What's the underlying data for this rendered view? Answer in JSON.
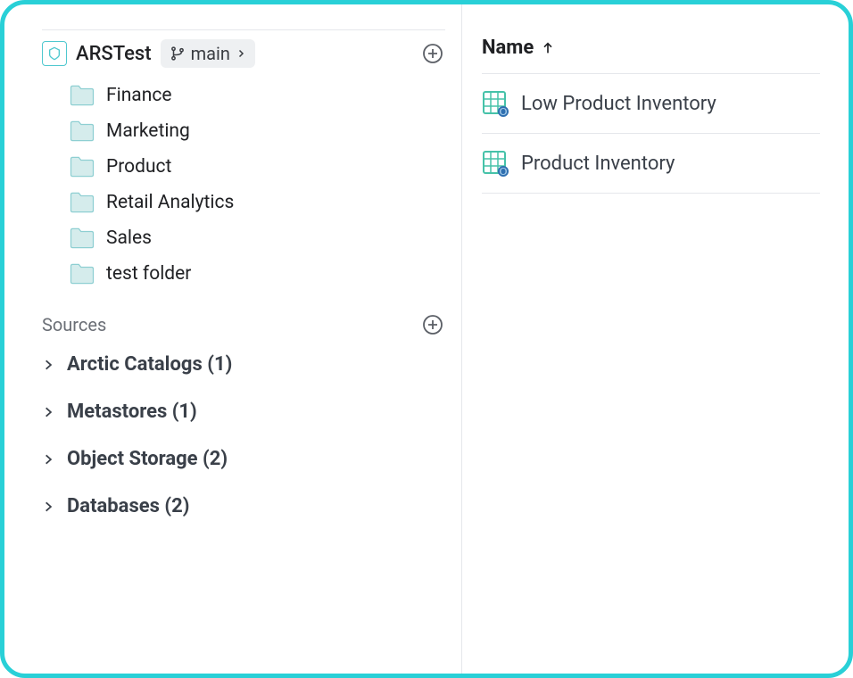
{
  "workspace": {
    "title": "ARSTest",
    "branch": "main",
    "folders": [
      {
        "label": "Finance"
      },
      {
        "label": "Marketing"
      },
      {
        "label": "Product"
      },
      {
        "label": "Retail Analytics"
      },
      {
        "label": "Sales"
      },
      {
        "label": "test folder"
      }
    ]
  },
  "sources": {
    "heading": "Sources",
    "items": [
      {
        "label": "Arctic Catalogs (1)"
      },
      {
        "label": "Metastores (1)"
      },
      {
        "label": "Object Storage (2)"
      },
      {
        "label": "Databases (2)"
      }
    ]
  },
  "content": {
    "column_header": "Name",
    "rows": [
      {
        "label": "Low Product Inventory"
      },
      {
        "label": "Product Inventory"
      }
    ]
  }
}
